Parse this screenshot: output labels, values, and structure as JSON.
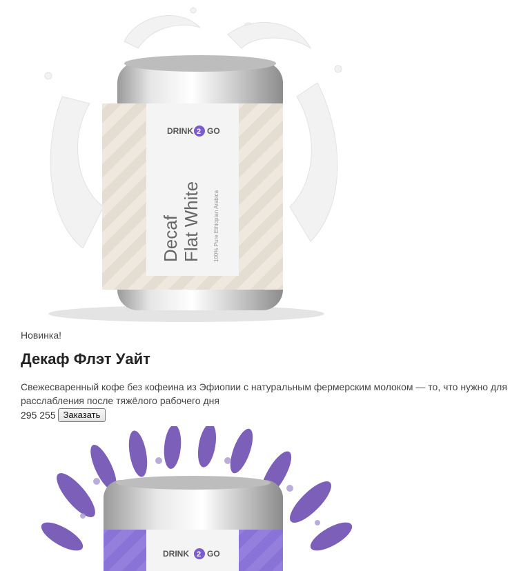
{
  "products": [
    {
      "badge": "Новинка!",
      "title": "Декаф Флэт Уайт",
      "description": "Свежесваренный кофе без кофеина из Эфиопии с натуральным фермерским молоком — то, что нужно для расслабления после тяжёлого рабочего дня",
      "price": "295 255",
      "order_label": "Заказать",
      "can": {
        "brand_left": "DRINK",
        "brand_mid": "2",
        "brand_right": "GO",
        "name_line1": "Decaf",
        "name_line2": "Flat White",
        "subtitle": "100% Pure Ethiopian Arabica",
        "label_color": "#ece6dc",
        "accent": "#7a5bd0"
      }
    },
    {
      "can": {
        "brand_left": "DRINK",
        "brand_mid": "2",
        "brand_right": "GO",
        "label_color": "#8f79d9",
        "accent": "#7a5bd0"
      }
    }
  ]
}
